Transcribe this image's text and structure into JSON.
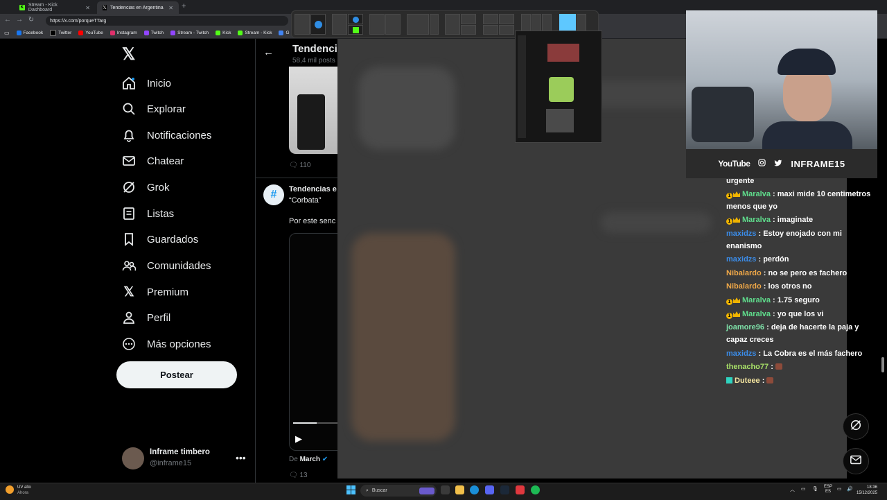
{
  "browser": {
    "tabs": [
      {
        "label": "Stream - Kick Dashboard",
        "icon": "kick-icon"
      },
      {
        "label": "Tendencias en Argentina (@porqu",
        "icon": "x-icon"
      }
    ],
    "url": "https://x.com/porqueTTarg",
    "bookmarks": [
      "Facebook",
      "Twitter",
      "YouTube",
      "Instagram",
      "Twitch",
      "Stream - Twitch",
      "Kick",
      "Stream - Kick",
      "G"
    ]
  },
  "sidebar": {
    "items": [
      {
        "label": "Inicio",
        "icon": "home-icon"
      },
      {
        "label": "Explorar",
        "icon": "search-icon"
      },
      {
        "label": "Notificaciones",
        "icon": "bell-icon"
      },
      {
        "label": "Chatear",
        "icon": "mail-icon"
      },
      {
        "label": "Grok",
        "icon": "grok-icon"
      },
      {
        "label": "Listas",
        "icon": "list-icon"
      },
      {
        "label": "Guardados",
        "icon": "bookmark-icon"
      },
      {
        "label": "Comunidades",
        "icon": "communities-icon"
      },
      {
        "label": "Premium",
        "icon": "x-premium-icon"
      },
      {
        "label": "Perfil",
        "icon": "person-icon"
      },
      {
        "label": "Más opciones",
        "icon": "more-icon"
      }
    ],
    "post_label": "Postear",
    "user": {
      "name": "Inframe timbero",
      "handle": "@inframe15"
    }
  },
  "main": {
    "title": "Tendenci",
    "subtitle": "58,4 mil posts",
    "reply_count_1": "110",
    "trend_name": "Tendencias e",
    "trend_quote": "“Corbata”",
    "trend_text": "Por este senc",
    "source_prefix": "De",
    "source_name": "March",
    "reply_count_2": "13"
  },
  "stream_overlay": {
    "youtube_label": "YouTube",
    "brand": "INFRAME15"
  },
  "chat": {
    "messages": [
      {
        "user": "",
        "text": "urgente",
        "color": "#ffffff",
        "badge": "none"
      },
      {
        "user": "Maralva",
        "text": "maxi mide 10 centimetros menos que yo",
        "color": "#5fdc8c",
        "badge": "sub"
      },
      {
        "user": "Maralva",
        "text": "imaginate",
        "color": "#5fdc8c",
        "badge": "sub"
      },
      {
        "user": "maxidzs",
        "text": "Estoy enojado con mi enanismo",
        "color": "#3b8ce8",
        "badge": "none"
      },
      {
        "user": "maxidzs",
        "text": "perdón",
        "color": "#3b8ce8",
        "badge": "none"
      },
      {
        "user": "Nibalardo",
        "text": "no se pero es fachero",
        "color": "#f0a848",
        "badge": "none"
      },
      {
        "user": "Nibalardo",
        "text": "los otros no",
        "color": "#f0a848",
        "badge": "none"
      },
      {
        "user": "Maralva",
        "text": "1.75 seguro",
        "color": "#5fdc8c",
        "badge": "sub"
      },
      {
        "user": "Maralva",
        "text": "yo que los vi",
        "color": "#5fdc8c",
        "badge": "sub"
      },
      {
        "user": "joamore96",
        "text": "deja de hacerte la paja y capaz creces",
        "color": "#7ee0a8",
        "badge": "none"
      },
      {
        "user": "maxidzs",
        "text": "La Cobra es el más fachero",
        "color": "#3b8ce8",
        "badge": "none"
      },
      {
        "user": "thenacho77",
        "text": "",
        "color": "#a8e068",
        "badge": "none",
        "emote": true
      },
      {
        "user": "Duteee",
        "text": "",
        "color": "#f5e6a0",
        "badge": "teal",
        "emote": true
      }
    ]
  },
  "taskbar": {
    "weather_title": "UV alto",
    "weather_sub": "Ahora",
    "search_placeholder": "Buscar",
    "lang_top": "ESP",
    "lang_bottom": "ES",
    "time": "18:36",
    "date": "15/12/2025"
  }
}
